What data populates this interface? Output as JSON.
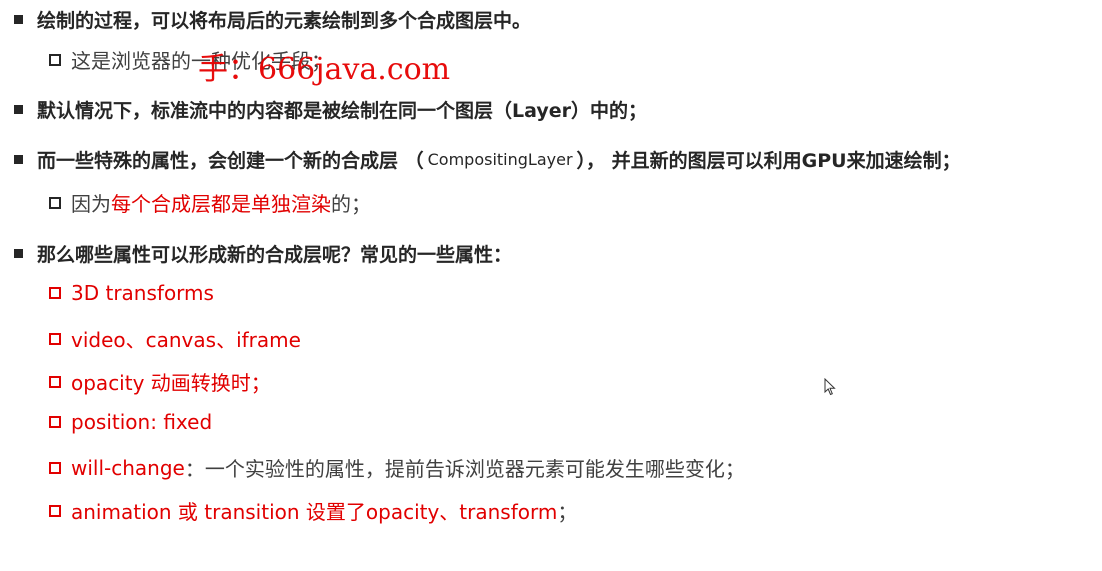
{
  "items": [
    {
      "text": "绘制的过程，可以将布局后的元素绘制到多个合成图层中。"
    },
    {
      "text": "这是浏览器的一种优化手段；"
    },
    {
      "text": "默认情况下，标准流中的内容都是被绘制在同一个图层（Layer）中的；"
    },
    {
      "before": "而一些特殊的属性，会创建一个新的合成层 （",
      "latin": "CompositingLayer",
      "after": "）， 并且新的图层可以利用GPU来加速绘制；"
    },
    {
      "before": "因为",
      "red": "每个合成层都是单独渲染",
      "after": "的；"
    },
    {
      "text": "那么哪些属性可以形成新的合成层呢？常见的一些属性："
    }
  ],
  "properties": [
    {
      "red": "3D transforms",
      "rest": ""
    },
    {
      "red": "video、canvas、iframe",
      "rest": ""
    },
    {
      "red": "opacity 动画转换时；",
      "rest": ""
    },
    {
      "red": "position: fixed",
      "rest": ""
    },
    {
      "red": "will-change",
      "rest": "：一个实验性的属性，提前告诉浏览器元素可能发生哪些变化；"
    },
    {
      "red": "animation 或 transition 设置了opacity、transform",
      "rest": "；"
    }
  ],
  "watermark": "手：666java.com",
  "colors": {
    "accent": "#e10000",
    "text": "#262626"
  }
}
